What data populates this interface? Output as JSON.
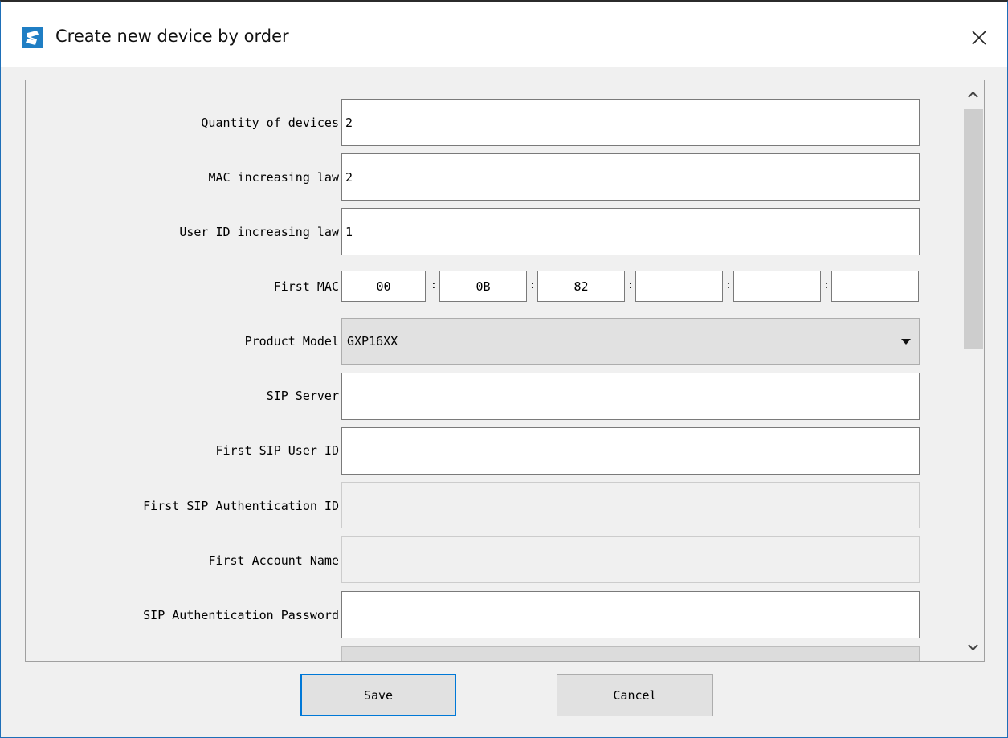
{
  "window": {
    "title": "Create new device by order"
  },
  "form": {
    "quantity": {
      "label": "Quantity of devices",
      "value": "2"
    },
    "mac_law": {
      "label": "MAC increasing law",
      "value": "2"
    },
    "userid_law": {
      "label": "User ID increasing law",
      "value": "1"
    },
    "first_mac": {
      "label": "First MAC",
      "octets": [
        "00",
        "0B",
        "82",
        "",
        "",
        ""
      ],
      "separator": ":"
    },
    "product_model": {
      "label": "Product Model",
      "value": "GXP16XX"
    },
    "sip_server": {
      "label": "SIP Server",
      "value": ""
    },
    "first_sip_user_id": {
      "label": "First SIP User ID",
      "value": ""
    },
    "first_sip_auth_id": {
      "label": "First SIP Authentication ID",
      "value": ""
    },
    "first_account_name": {
      "label": "First Account Name",
      "value": ""
    },
    "sip_auth_password": {
      "label": "SIP Authentication Password",
      "value": ""
    }
  },
  "buttons": {
    "save": "Save",
    "cancel": "Cancel"
  },
  "icons": {
    "app": "app-logo-icon",
    "close": "close-icon",
    "scroll_up": "chevron-up-icon",
    "scroll_down": "chevron-down-icon",
    "dropdown": "dropdown-arrow-icon"
  },
  "colors": {
    "accent": "#0078d7",
    "brand_icon": "#1f7ec4"
  }
}
